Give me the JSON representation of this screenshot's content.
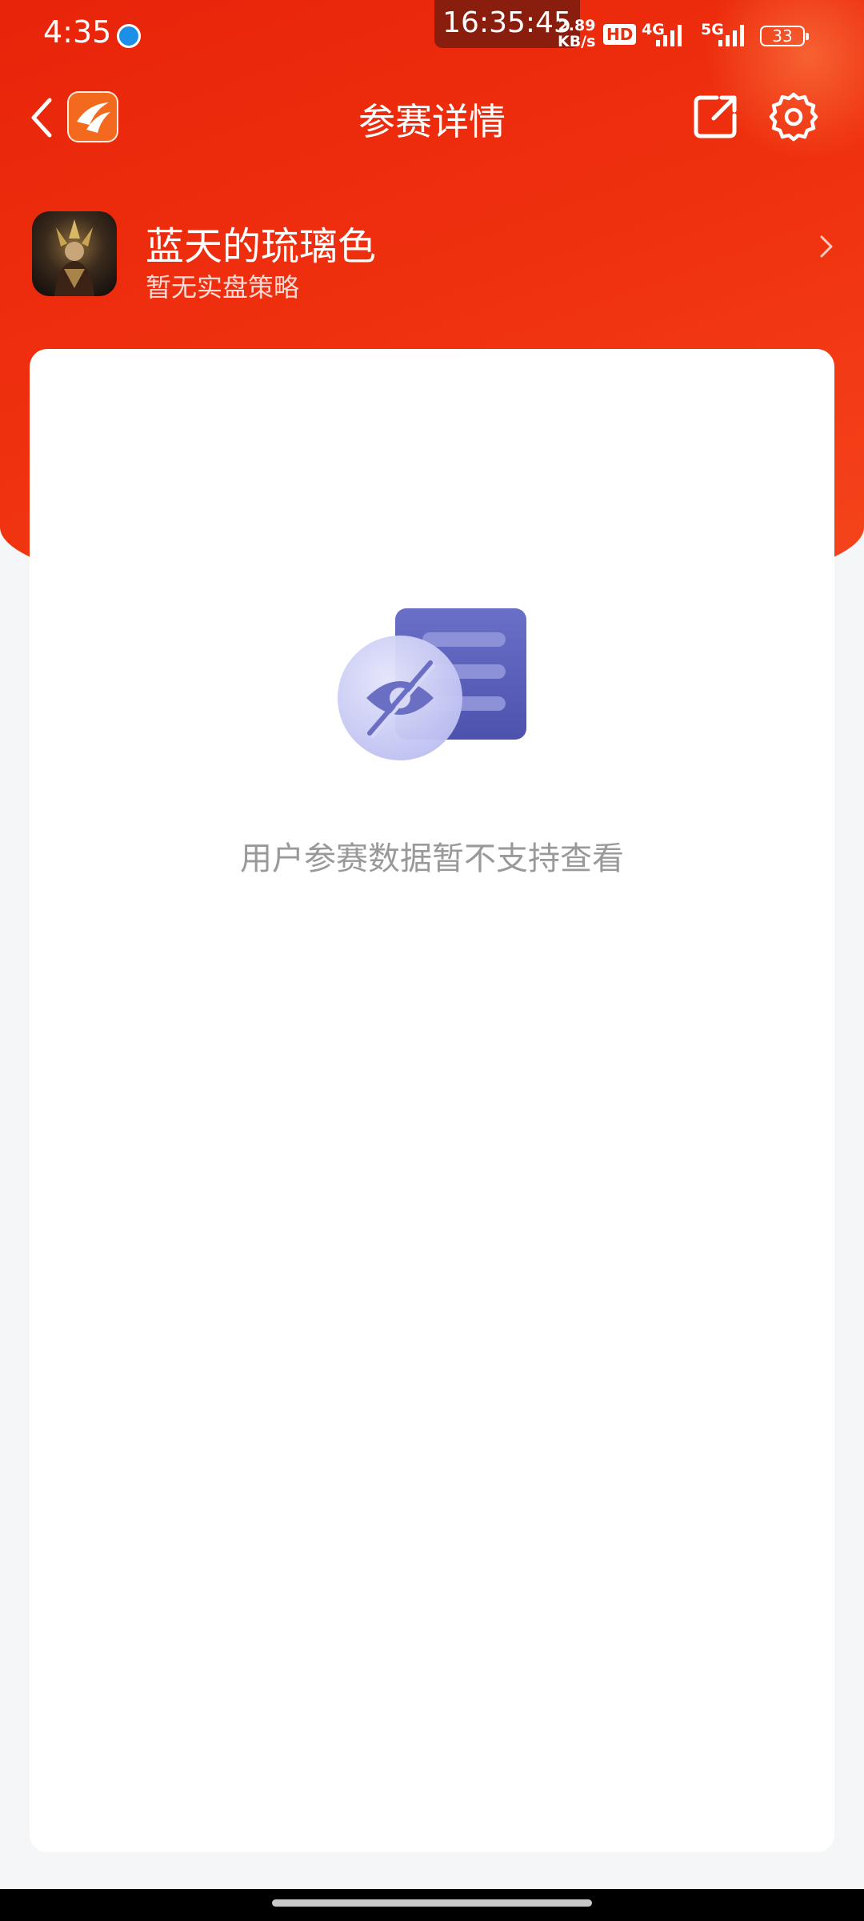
{
  "status_bar": {
    "time": "4:35",
    "overlay_clock": "16:35:45",
    "net_speed_value": "2.89",
    "net_speed_unit": "KB/s",
    "hd_badge": "HD",
    "network_1": "4G",
    "network_2": "5G",
    "battery": "33"
  },
  "header": {
    "title": "参赛详情",
    "back_icon": "chevron-left-icon",
    "share_icon": "share-external-icon",
    "settings_icon": "gear-icon"
  },
  "profile": {
    "name": "蓝天的琉璃色",
    "subtitle": "暂无实盘策略"
  },
  "empty_state": {
    "message": "用户参赛数据暂不支持查看",
    "icon": "hidden-document-icon"
  },
  "colors": {
    "brand_red": "#e8240a",
    "illustration_purple": "#5a5fb8",
    "empty_text": "#999999"
  }
}
